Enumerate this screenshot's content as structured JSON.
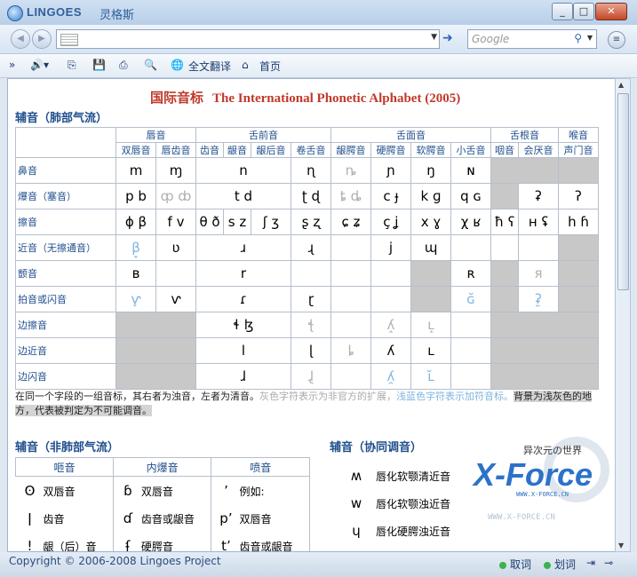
{
  "window": {
    "brand": "LINGOES",
    "brand_cn": "灵格斯"
  },
  "nav": {
    "search_placeholder": "Google"
  },
  "toolbar": {
    "translate_all": "全文翻译",
    "home": "首页"
  },
  "page": {
    "title_cn": "国际音标",
    "title_en": "The International Phonetic Alphabet (2005)",
    "pulmonic_title": "辅音（肺部气流）",
    "nonpulmonic_title": "辅音（非肺部气流）",
    "coart_title": "辅音（协同调音）"
  },
  "pulmonic": {
    "groups": [
      "唇音",
      "舌前音",
      "舌面音",
      "舌根音",
      "喉音"
    ],
    "places": [
      "双唇音",
      "唇齿音",
      "齿音",
      "龈音",
      "龈后音",
      "卷舌音",
      "龈腭音",
      "硬腭音",
      "软腭音",
      "小舌音",
      "咽音",
      "会厌音",
      "声门音"
    ],
    "manners": [
      "鼻音",
      "爆音（塞音）",
      "擦音",
      "近音（无擦通音）",
      "颤音",
      "拍音或闪音",
      "边擦音",
      "边近音",
      "边闪音"
    ],
    "cells": {
      "nasal": [
        "m",
        "ɱ",
        "n",
        "ɳ",
        "ȵ",
        "ɲ",
        "ŋ",
        "ɴ"
      ],
      "plosive": [
        "p b",
        "ȹ ȸ",
        "t d",
        "ʈ ɖ",
        "ȶ ȡ",
        "c ɟ",
        "k ɡ",
        "q ɢ",
        "ʡ",
        "ʔ"
      ],
      "fricative": [
        "ɸ β",
        "f v",
        "θ ð",
        "s z",
        "ʃ ʒ",
        "ʂ ʐ",
        "ɕ ʑ",
        "ç ʝ",
        "x ɣ",
        "χ",
        "ʁ",
        "ħ",
        "ʕ",
        "ʜ",
        "ʢ",
        "h ɦ"
      ],
      "approximant": [
        "β̞",
        "ʋ",
        "ɹ",
        "ɻ",
        "j",
        "ɰ"
      ],
      "trill": [
        "ʙ",
        "r",
        "ʀ",
        "я"
      ],
      "tap": [
        "ⱱ̟",
        "ⱱ",
        "ɾ",
        "ɽ",
        "ɢ̆",
        "ʡ̯"
      ],
      "lat_fric": [
        "ɬ ɮ",
        "ꞎ",
        "ʎ̝",
        "ʟ̝"
      ],
      "lat_approx": [
        "l",
        "ɭ",
        "ȴ",
        "ʎ",
        "ʟ"
      ],
      "lat_flap": [
        "ɺ",
        "ɺ̢",
        "ʎ̯",
        "ʟ̆"
      ]
    }
  },
  "note": {
    "a": "在同一个字段的一组音标，其右者为浊音，左者为清音。",
    "b": "灰色字符表示为非官方的扩展，",
    "c": "浅蓝色字符表示加符音标。",
    "d": "背景为浅灰色的地方，代表被判定为不可能调音。"
  },
  "nonpulmonic": {
    "headers": [
      "咂音",
      "内爆音",
      "喷音"
    ],
    "rows": [
      [
        "ʘ",
        "双唇音",
        "ɓ",
        "双唇音",
        "ʼ",
        "例如:"
      ],
      [
        "ǀ",
        "齿音",
        "ɗ",
        "齿音或龈音",
        "pʼ",
        "双唇音"
      ],
      [
        "ǃ",
        "龈（后）音",
        "ʄ",
        "硬腭音",
        "tʼ",
        "齿音或龈音"
      ]
    ]
  },
  "coart": [
    [
      "ʍ",
      "唇化软颚清近音"
    ],
    [
      "w",
      "唇化软颚浊近音"
    ],
    [
      "ɥ",
      "唇化硬腭浊近音"
    ]
  ],
  "watermark": {
    "brand": "X-Force",
    "tagline": "异次元の世界",
    "site": "WWW.X-FORCE.CN"
  },
  "status": {
    "copyright": "Copyright © 2006-2008 Lingoes Project",
    "fetch": "取词",
    "select": "划词"
  }
}
